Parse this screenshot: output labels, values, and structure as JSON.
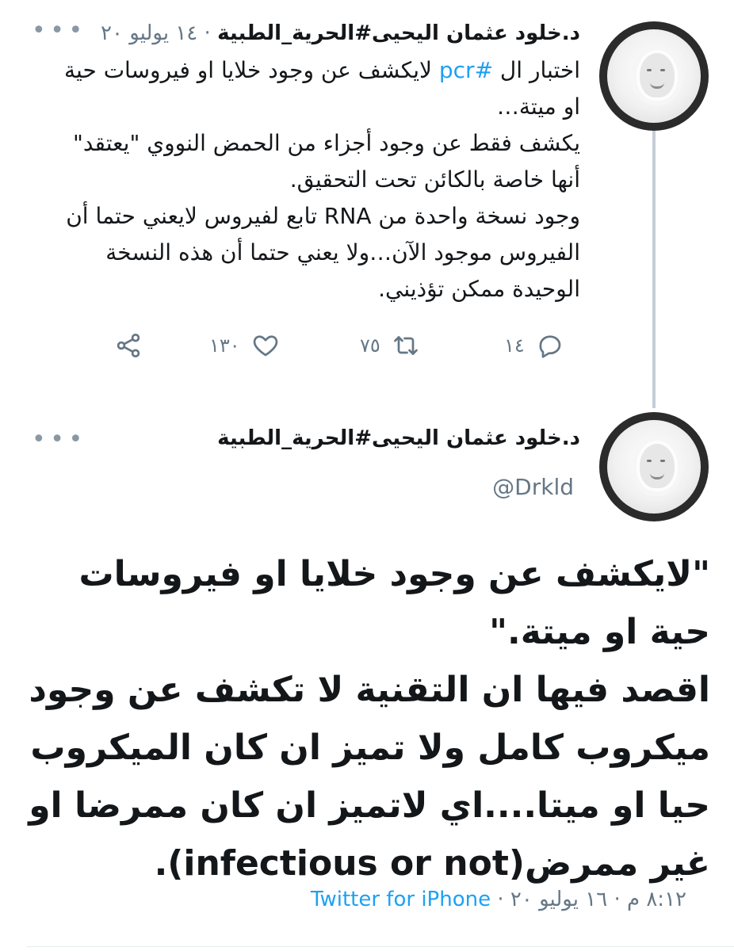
{
  "reply_tweet": {
    "author_name": "د.خلود عثمان اليحيى#الحرية_الطبية",
    "date": "١٤ يوليو ٢٠",
    "separator": "·",
    "text_before_link": "اختبار ال ",
    "link": "#pcr",
    "text_after_link": " لايكشف عن وجود خلايا او فيروسات حية او ميتة…\nيكشف فقط عن وجود أجزاء من الحمض النووي \"يعتقد\" أنها خاصة بالكائن تحت التحقيق.\nوجود نسخة واحدة من RNA تابع لفيروس لايعني حتما أن الفيروس موجود الآن…ولا يعني حتما أن هذه النسخة الوحيدة ممكن تؤذيني.",
    "actions": {
      "reply_count": "١٤",
      "retweet_count": "٧٥",
      "like_count": "١٣٠"
    }
  },
  "main_tweet": {
    "author_name": "د.خلود عثمان اليحيى#الحرية_الطبية",
    "handle": "@Drkld",
    "text": "\"لايكشف عن وجود خلايا او فيروسات حية او ميتة.\"\nاقصد فيها ان التقنية لا تكشف عن وجود ميكروب كامل ولا تميز ان كان الميكروب حيا او ميتا....اي لاتميز ان كان ممرضا او غير ممرض(infectious or not).",
    "time": "٨:١٢ م",
    "date": "١٦ يوليو ٢٠",
    "separator": "·",
    "source": "Twitter for iPhone"
  },
  "icons": {
    "reply": "reply-icon",
    "retweet": "retweet-icon",
    "like": "heart-icon",
    "share": "share-icon",
    "more": "more-icon"
  },
  "colors": {
    "link": "#1da1f2",
    "muted": "#657786",
    "text": "#14171a",
    "thread_line": "#c5ced6"
  }
}
